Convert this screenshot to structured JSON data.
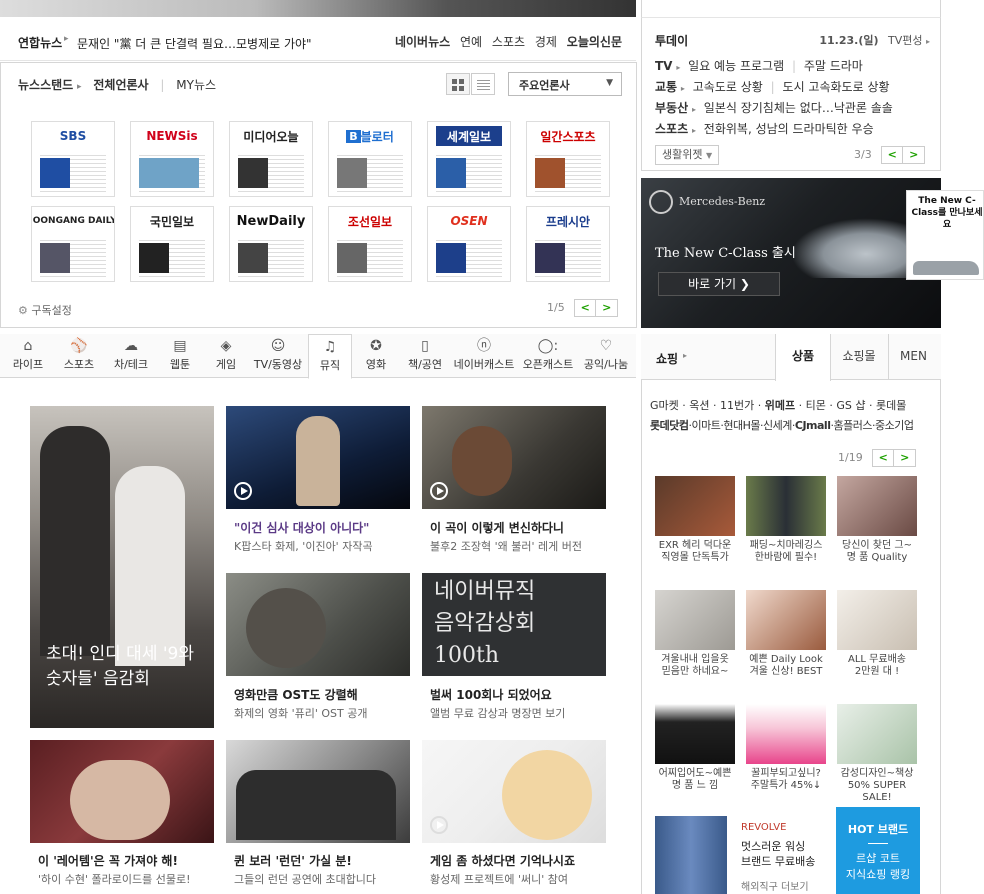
{
  "news_headline": {
    "source": "연합뉴스",
    "headline": "문재인 \"黨 더 큰 단결력 필요…모병제로 가야\"",
    "links": [
      "네이버뉴스",
      "연예",
      "스포츠",
      "경제",
      "오늘의신문"
    ]
  },
  "newsstand": {
    "tabs": [
      "뉴스스탠드",
      "전체언론사",
      "MY뉴스"
    ],
    "select_label": "주요언론사",
    "publishers": [
      "SBS",
      "NEWSis",
      "미디어오늘",
      "블로터",
      "세계일보",
      "일간스포츠",
      "JOONGANG DAILY",
      "국민일보",
      "NewDaily",
      "조선일보",
      "OSEN",
      "프레시안"
    ],
    "settings_label": "구독설정",
    "page": "1/5"
  },
  "today": {
    "title": "투데이",
    "date": "11.23.(일)",
    "tv_link": "TV편성",
    "rows": [
      {
        "cat": "TV",
        "items": [
          "일요 예능 프로그램",
          "주말 드라마"
        ]
      },
      {
        "cat": "교통",
        "items": [
          "고속도로 상황",
          "도시 고속화도로 상황"
        ]
      },
      {
        "cat": "부동산",
        "items": [
          "일본식 장기침체는 없다…낙관론 솔솔"
        ]
      },
      {
        "cat": "스포츠",
        "items": [
          "전화위복, 성남의 드라마틱한 우승"
        ]
      }
    ],
    "weather_btn": "생활위젯",
    "page": "3/3"
  },
  "ad": {
    "brand": "Mercedes-Benz",
    "headline": "The New C-Class 출시",
    "button": "바로 가기",
    "popout": "The New C-Class를 만나보세요"
  },
  "categories": [
    "라이프",
    "스포츠",
    "차/테크",
    "웹툰",
    "게임",
    "TV/동영상",
    "뮤직",
    "영화",
    "책/공연",
    "네이버캐스트",
    "오픈캐스트",
    "공익/나눔"
  ],
  "music": {
    "feature_title": "초대! 인디 대세 '9와 숫자들' 음감회",
    "cards": [
      {
        "title": "\"이건 심사 대상이 아니다\"",
        "sub": "K팝스타 화제, '이진아' 자작곡"
      },
      {
        "title": "이 곡이 이렇게 변신하다니",
        "sub": "불후2 조장혁 '왜 불러' 레게 버전"
      },
      {
        "title": "영화만큼 OST도 강렬해",
        "sub": "화제의 영화 '퓨리' OST 공개"
      },
      {
        "title": "벌써 100회나 되었어요",
        "sub": "앨범 무료 감상과 명장면 보기"
      },
      {
        "title": "이 '레어템'은 꼭 가져야 해!",
        "sub": "'하이 수현' 폴라로이드를 선물로!"
      },
      {
        "title": "퀸 보러 '런던' 가실 분!",
        "sub": "그들의 런던 공연에 초대합니다"
      },
      {
        "title": "게임 좀 하셨다면 기억나시죠",
        "sub": "황성제 프로젝트에 '써니' 참여"
      }
    ],
    "banner_lines": [
      "네이버뮤직",
      "음악감상회",
      "100th"
    ]
  },
  "shopping": {
    "title": "쇼핑",
    "tabs": [
      "상품",
      "쇼핑몰",
      "MEN"
    ],
    "links_row1": [
      "G마켓",
      "옥션",
      "11번가",
      "위메프",
      "티몬",
      "GS 샵",
      "롯데몰"
    ],
    "links_row2": [
      "롯데닷컴",
      "이마트",
      "현대H몰",
      "신세계",
      "CJmall",
      "홈플러스",
      "중소기업"
    ],
    "page": "1/19",
    "items": [
      {
        "l1": "EXR 헤리 덕다운",
        "l2": "직영몰 단독특가"
      },
      {
        "l1": "패딩~치마레깅스",
        "l2": "한바람에 필수!"
      },
      {
        "l1": "당신이 찾던 그~",
        "l2": "명 품 Quality"
      },
      {
        "l1": "겨울내내 입을옷",
        "l2": "믿음만 하네요~"
      },
      {
        "l1": "예쁜 Daily Look",
        "l2": "겨울 신상! BEST"
      },
      {
        "l1": "ALL 무료배송",
        "l2": "2만원 대 !"
      },
      {
        "l1": "어찌입어도~예쁜",
        "l2": "명 품 느 낌"
      },
      {
        "l1": "꿀피부되고싶니?",
        "l2": "주말특가 45%↓"
      },
      {
        "l1": "감성디자인~책상",
        "l2": "50% SUPER SALE!"
      }
    ],
    "revolve": {
      "brand": "REVOLVE",
      "l1": "멋스러운 워싱",
      "l2": "브랜드 무료배송",
      "l3": "해외직구 더보기"
    },
    "hot": {
      "title": "HOT 브랜드",
      "l1": "르샵 코트",
      "l2": "지식쇼핑 랭킹"
    }
  },
  "colors": {
    "green": "#1ea100",
    "border": "#d6d6d6",
    "hot_blue": "#1e9be0"
  }
}
